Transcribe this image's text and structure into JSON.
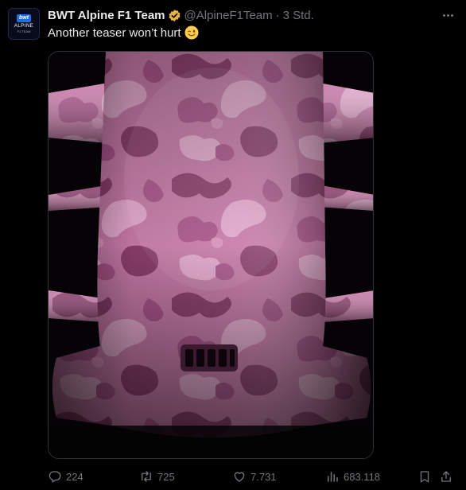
{
  "author": {
    "name": "BWT Alpine F1 Team",
    "handle": "@AlpineF1Team",
    "separator": "·",
    "time": "3 Std.",
    "avatar_text": {
      "brand": "bwt",
      "team": "ALPINE",
      "sub": "F1 TEAM"
    }
  },
  "tweet": {
    "text": "Another teaser won’t hurt",
    "emoji": "winking-face",
    "media_description": "pink-camo-car-livery-teaser"
  },
  "actions": {
    "replies": "224",
    "reposts": "725",
    "likes": "7.731",
    "views": "683.118"
  },
  "colors": {
    "background": "#000000",
    "text_primary": "#e7e9ea",
    "text_secondary": "#71767b",
    "verified_badge": "#e8b339",
    "camo_base": "#c77aa8",
    "camo_dark": "#8c3f6d",
    "camo_light": "#e3a8cc"
  }
}
